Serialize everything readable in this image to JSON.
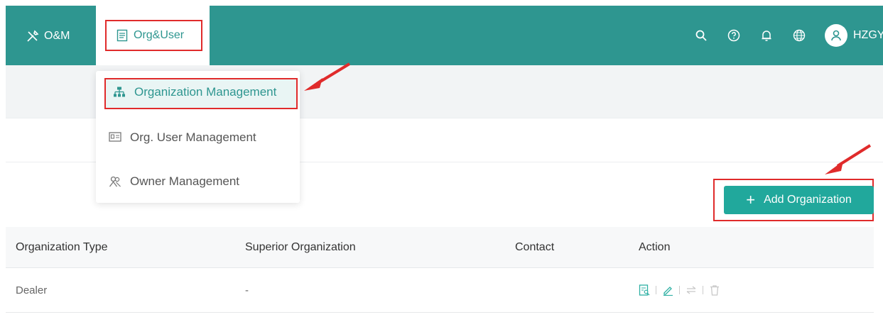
{
  "topbar": {
    "om_label": "O&M",
    "org_user_label": "Org&User",
    "username": "HZGY",
    "icons": [
      "search-icon",
      "help-icon",
      "bell-icon",
      "globe-icon",
      "user-avatar-icon"
    ]
  },
  "dropdown": {
    "items": [
      {
        "label": "Organization Management",
        "icon": "org-tree-icon",
        "active": true
      },
      {
        "label": "Org. User Management",
        "icon": "id-card-icon",
        "active": false
      },
      {
        "label": "Owner Management",
        "icon": "users-icon",
        "active": false
      }
    ]
  },
  "toolbar": {
    "add_label": "Add Organization"
  },
  "table": {
    "columns": [
      "Organization Type",
      "Superior Organization",
      "Contact",
      "Action"
    ],
    "rows": [
      {
        "type": "Dealer",
        "superior": "-",
        "contact": ""
      }
    ]
  },
  "colors": {
    "primary": "#2e9690",
    "button": "#21a89c",
    "highlight_border": "#e02b2b"
  }
}
